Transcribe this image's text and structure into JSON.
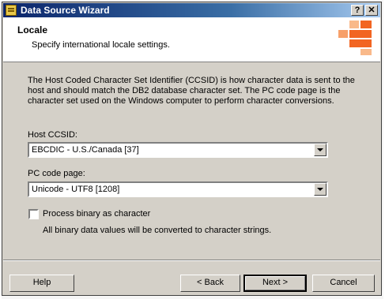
{
  "window": {
    "title": "Data Source Wizard",
    "help_button": "?",
    "close_button": "✕"
  },
  "header": {
    "title": "Locale",
    "subtitle": "Specify international locale settings."
  },
  "description": "The Host Coded Character Set Identifier (CCSID) is how character data is sent to the host and should match the DB2 database character set. The PC code page is the character set used on the Windows computer to perform character conversions.",
  "host_ccsid": {
    "label": "Host CCSID:",
    "value": "EBCDIC - U.S./Canada [37]"
  },
  "pc_code_page": {
    "label": "PC code page:",
    "value": "Unicode - UTF8 [1208]"
  },
  "process_binary": {
    "label": "Process binary as character",
    "checked": false,
    "note": "All binary data values will be converted to character strings."
  },
  "buttons": {
    "help": "Help",
    "back": "< Back",
    "next": "Next >",
    "cancel": "Cancel"
  },
  "colors": {
    "title_bar": "#0a246a",
    "logo_orange": "#f26522",
    "dialog_face": "#d4d0c8"
  }
}
